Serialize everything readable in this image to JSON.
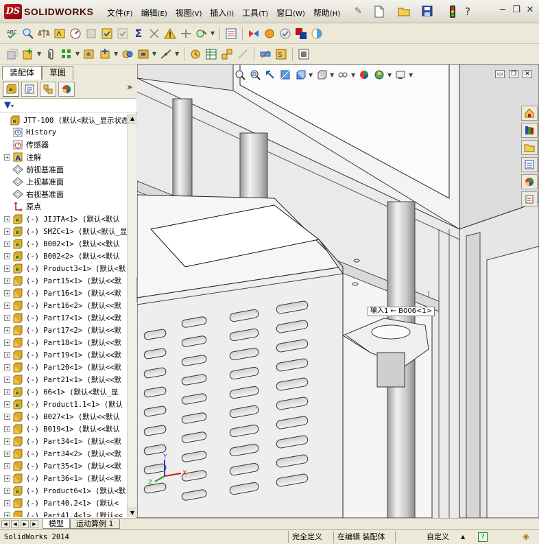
{
  "app": {
    "logo_prefix": "DS",
    "logo_name": "SOLIDWORKS"
  },
  "menu": [
    {
      "label": "文件",
      "key": "(F)"
    },
    {
      "label": "编辑",
      "key": "(E)"
    },
    {
      "label": "视图",
      "key": "(V)"
    },
    {
      "label": "插入",
      "key": "(I)"
    },
    {
      "label": "工具",
      "key": "(T)"
    },
    {
      "label": "窗口",
      "key": "(W)"
    },
    {
      "label": "帮助",
      "key": "(H)"
    }
  ],
  "panel_tabs": {
    "assembly": "装配体",
    "sketch": "草图"
  },
  "tree": {
    "root": "JTT-100  (默认<默认_显示状态",
    "items": [
      {
        "label": "History",
        "type": "history"
      },
      {
        "label": "传感器",
        "type": "sensor"
      },
      {
        "label": "注解",
        "type": "annotation"
      },
      {
        "label": "前视基准面",
        "type": "plane"
      },
      {
        "label": "上视基准面",
        "type": "plane"
      },
      {
        "label": "右视基准面",
        "type": "plane"
      },
      {
        "label": "原点",
        "type": "origin"
      },
      {
        "label": "(-) JIJTA<1> (默认<默认",
        "type": "assembly"
      },
      {
        "label": "(-) SMZC<1> (默认<默认_显",
        "type": "assembly"
      },
      {
        "label": "(-) B002<1> (默认<<默认",
        "type": "assembly"
      },
      {
        "label": "(-) B002<2> (默认<<默认",
        "type": "assembly"
      },
      {
        "label": "(-) Product3<1> (默认<默",
        "type": "assembly"
      },
      {
        "label": "(-) Part15<1> (默认<<默",
        "type": "part"
      },
      {
        "label": "(-) Part16<1> (默认<<默",
        "type": "part"
      },
      {
        "label": "(-) Part16<2> (默认<<默",
        "type": "part"
      },
      {
        "label": "(-) Part17<1> (默认<<默",
        "type": "part"
      },
      {
        "label": "(-) Part17<2> (默认<<默",
        "type": "part"
      },
      {
        "label": "(-) Part18<1> (默认<<默",
        "type": "part"
      },
      {
        "label": "(-) Part19<1> (默认<<默",
        "type": "part"
      },
      {
        "label": "(-) Part20<1> (默认<<默",
        "type": "part"
      },
      {
        "label": "(-) Part21<1> (默认<<默",
        "type": "part"
      },
      {
        "label": "(-) 66<1> (默认<默认_显",
        "type": "assembly"
      },
      {
        "label": "(-) Product1.1<1> (默认",
        "type": "assembly"
      },
      {
        "label": "(-) B027<1> (默认<<默认",
        "type": "part"
      },
      {
        "label": "(-) B019<1> (默认<<默认",
        "type": "part"
      },
      {
        "label": "(-) Part34<1> (默认<<默",
        "type": "part"
      },
      {
        "label": "(-) Part34<2> (默认<<默",
        "type": "part"
      },
      {
        "label": "(-) Part35<1> (默认<<默",
        "type": "part"
      },
      {
        "label": "(-) Part36<1> (默认<<默",
        "type": "part"
      },
      {
        "label": "(-) Product6<1> (默认<默",
        "type": "assembly"
      },
      {
        "label": "(-) Part40.2<1> (默认<",
        "type": "part"
      },
      {
        "label": "(-) Part41.4<1> (默认<<",
        "type": "part"
      }
    ]
  },
  "viewport": {
    "mate_callout": "输入1 ← B006<1>"
  },
  "bottom_tabs": {
    "model": "模型",
    "motion": "运动算例 1"
  },
  "status": {
    "app_version": "SolidWorks 2014",
    "definition": "完全定义",
    "editing": "在编辑 装配体",
    "units": "自定义",
    "help": "?"
  }
}
